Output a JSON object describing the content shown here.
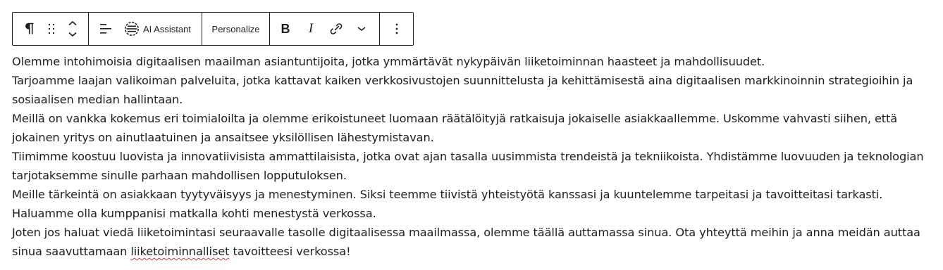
{
  "toolbar": {
    "block_group": {
      "paragraph_icon": "paragraph-icon",
      "drag_icon": "drag-handle-icon",
      "move_icon": "move-up-down-icon"
    },
    "align_group": {
      "align_icon": "align-left-icon",
      "ai_icon": "ai-assistant-icon",
      "ai_label": "AI Assistant"
    },
    "personalize_label": "Personalize",
    "format_group": {
      "bold_label": "B",
      "italic_label": "I",
      "link_icon": "link-icon",
      "more_icon": "chevron-down-icon"
    },
    "options_icon": "more-vertical-icon"
  },
  "paragraphs": [
    {
      "text": "Olemme intohimoisia digitaalisen maailman asiantuntijoita, jotka ymmärtävät nykypäivän liiketoiminnan haasteet ja mahdollisuudet."
    },
    {
      "text": "Tarjoamme laajan valikoiman palveluita, jotka kattavat kaiken verkkosivustojen suunnittelusta ja kehittämisestä aina digitaalisen markkinoinnin strategioihin ja sosiaalisen median hallintaan."
    },
    {
      "text": "Meillä on vankka kokemus eri toimialoilta ja olemme erikoistuneet luomaan räätälöityjä ratkaisuja jokaiselle asiakkaallemme. Uskomme vahvasti siihen, että jokainen yritys on ainutlaatuinen ja ansaitsee yksilöllisen lähestymistavan."
    },
    {
      "text": "Tiimimme koostuu luovista ja innovatiivisista ammattilaisista, jotka ovat ajan tasalla uusimmista trendeistä ja tekniikoista. Yhdistämme luovuuden ja teknologian tarjotaksemme sinulle parhaan mahdollisen lopputuloksen."
    },
    {
      "text": "Meille tärkeintä on asiakkaan tyytyväisyys ja menestyminen. Siksi teemme tiivistä yhteistyötä kanssasi ja kuuntelemme tarpeitasi ja tavoitteitasi tarkasti. Haluamme olla kumppanisi matkalla kohti menestystä verkossa."
    },
    {
      "text_before": "Joten jos haluat viedä liiketoimintasi seuraavalle tasolle digitaalisessa maailmassa, olemme täällä auttamassa sinua. Ota yhteyttä meihin ja anna meidän auttaa sinua saavuttamaan ",
      "misspelled": "liiketoiminnalliset",
      "text_after": " tavoitteesi verkossa!"
    }
  ],
  "colors": {
    "text": "#1e1e1e",
    "border": "#1e1e1e",
    "spellcheck": "#d63638"
  }
}
